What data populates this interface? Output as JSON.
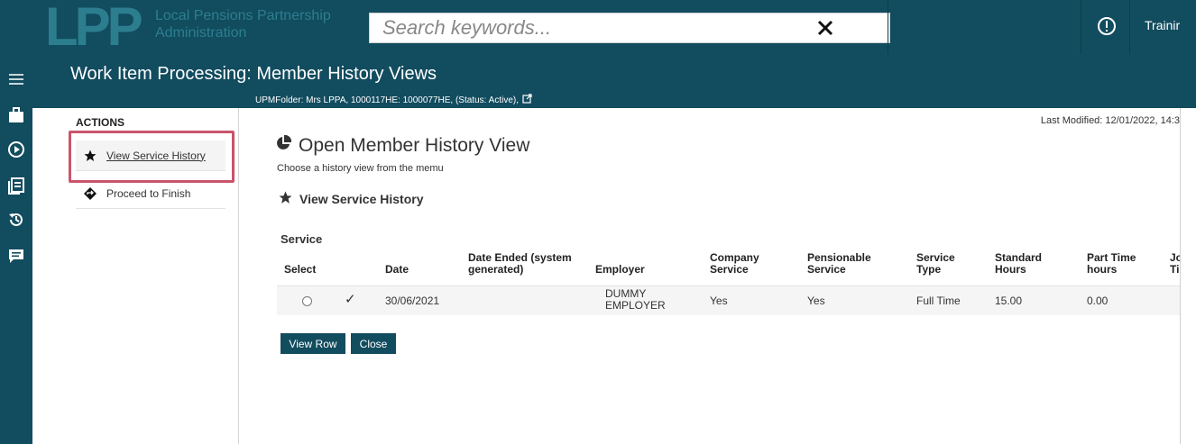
{
  "topbar": {
    "logo_letters": "LPP",
    "logo_line1": "Local Pensions Partnership",
    "logo_line2": "Administration",
    "search_placeholder": "Search keywords...",
    "user_name": "Trainir"
  },
  "titlebar": {
    "title": "Work Item Processing: Member History Views",
    "subtitle": "UPMFolder: Mrs LPPA, 1000117HE: 1000077HE, (Status: Active),"
  },
  "actions": {
    "heading": "ACTIONS",
    "items": [
      {
        "label": "View Service History",
        "icon": "star-icon"
      },
      {
        "label": "Proceed to Finish",
        "icon": "diamond-arrow-icon"
      }
    ]
  },
  "main": {
    "last_modified": "Last Modified: 12/01/2022, 14:3",
    "open_title": "Open Member History View",
    "choose_text": "Choose a history view from the memu",
    "section_heading": "View Service History",
    "service_label": "Service",
    "table": {
      "headers": [
        "Select",
        "Date",
        "Date Ended (system generated)",
        "Employer",
        "Company Service",
        "Pensionable Service",
        "Service Type",
        "Standard Hours",
        "Part Time hours",
        "Jo Ti"
      ],
      "headers_split": {
        "select": "Select",
        "date": "Date",
        "date_ended_1": "Date Ended (system",
        "date_ended_2": "generated)",
        "employer": "Employer",
        "company_1": "Company",
        "company_2": "Service",
        "pensionable_1": "Pensionable",
        "pensionable_2": "Service",
        "service_type_1": "Service",
        "service_type_2": "Type",
        "standard_1": "Standard",
        "standard_2": "Hours",
        "part_time_1": "Part Time",
        "part_time_2": "hours",
        "job_1": "Jo",
        "job_2": "Ti"
      },
      "rows": [
        {
          "selected_mark": "✓",
          "date": "30/06/2021",
          "date_ended": "",
          "employer_1": "DUMMY",
          "employer_2": "EMPLOYER",
          "company_service": "Yes",
          "pensionable_service": "Yes",
          "service_type": "Full Time",
          "standard_hours": "15.00",
          "part_time_hours": "0.00"
        }
      ]
    },
    "buttons": {
      "view_row": "View Row",
      "close": "Close"
    }
  },
  "colors": {
    "primary": "#124c5f",
    "highlight": "#c9546c"
  }
}
